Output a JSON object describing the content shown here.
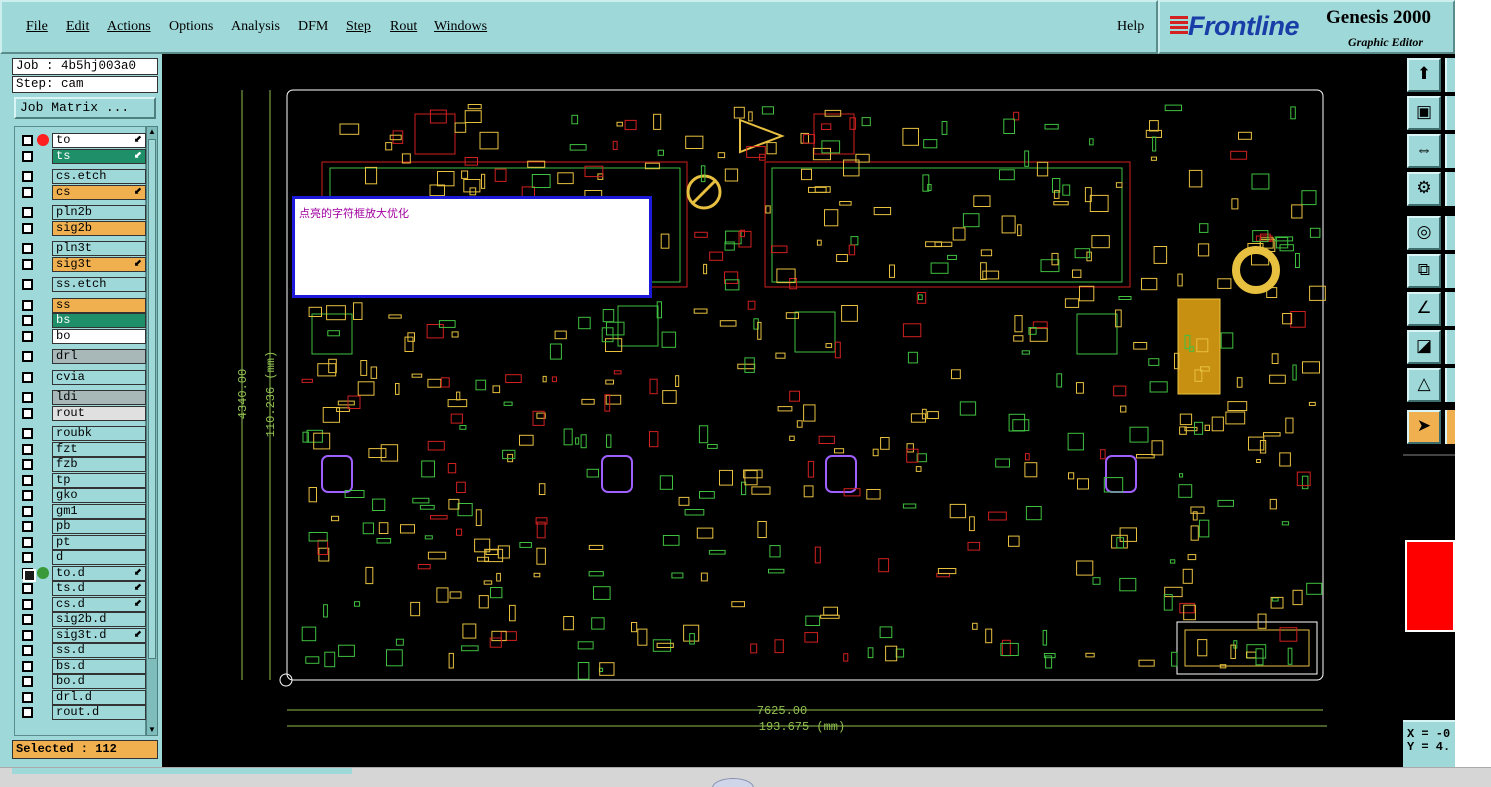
{
  "menubar": {
    "items": [
      {
        "label": "File",
        "underline": true
      },
      {
        "label": "Edit",
        "underline": true
      },
      {
        "label": "Actions",
        "underline": true
      },
      {
        "label": "Options",
        "underline": false
      },
      {
        "label": "Analysis",
        "underline": false
      },
      {
        "label": "DFM",
        "underline": false
      },
      {
        "label": "Step",
        "underline": true
      },
      {
        "label": "Rout",
        "underline": true
      },
      {
        "label": "Windows",
        "underline": true
      }
    ],
    "help": "Help"
  },
  "logo": {
    "brand": "Frontline",
    "product": "Genesis 2000",
    "subtitle": "Graphic Editor"
  },
  "job": {
    "job_line": "Job : 4b5hj003a0",
    "step_line": "Step: cam",
    "matrix_button": "Job Matrix ..."
  },
  "layers": [
    {
      "name": "to",
      "color": "#ffffff",
      "dot": "#ff2020",
      "arrow": true
    },
    {
      "name": "ts",
      "color": "#1f8f6a",
      "arrow": true,
      "textColor": "#ffffff"
    },
    {
      "name": "cs.etch",
      "color": "#9fd8d8",
      "gap": true
    },
    {
      "name": "cs",
      "color": "#f0b050",
      "arrow": true
    },
    {
      "name": "pln2b",
      "color": "#9fd8d8",
      "gap": true
    },
    {
      "name": "sig2b",
      "color": "#f0b050"
    },
    {
      "name": "pln3t",
      "color": "#9fd8d8",
      "gap": true
    },
    {
      "name": "sig3t",
      "color": "#f0b050",
      "arrow": true
    },
    {
      "name": "ss.etch",
      "color": "#9fd8d8",
      "gap": true
    },
    {
      "name": "ss",
      "color": "#f0b050",
      "gap": true
    },
    {
      "name": "bs",
      "color": "#1f8f6a",
      "textColor": "#ffffff"
    },
    {
      "name": "bo",
      "color": "#ffffff"
    },
    {
      "name": "drl",
      "color": "#a8b8b8",
      "gap": true
    },
    {
      "name": "cvia",
      "color": "#9fd8d8",
      "gap": true
    },
    {
      "name": "ldi",
      "color": "#a8b8b8",
      "gap": true
    },
    {
      "name": "rout",
      "color": "#e0e0e0"
    },
    {
      "name": "roubk",
      "color": "#9fd8d8",
      "gap": true
    },
    {
      "name": "fzt",
      "color": "#9fd8d8"
    },
    {
      "name": "fzb",
      "color": "#9fd8d8"
    },
    {
      "name": "tp",
      "color": "#9fd8d8"
    },
    {
      "name": "gko",
      "color": "#9fd8d8"
    },
    {
      "name": "gm1",
      "color": "#9fd8d8"
    },
    {
      "name": "pb",
      "color": "#9fd8d8"
    },
    {
      "name": "pt",
      "color": "#9fd8d8"
    },
    {
      "name": "d",
      "color": "#9fd8d8"
    },
    {
      "name": "to.d",
      "color": "#9fd8d8",
      "dot": "#3a9a3a",
      "arrow": true,
      "active": true
    },
    {
      "name": "ts.d",
      "color": "#9fd8d8",
      "arrow": true
    },
    {
      "name": "cs.d",
      "color": "#9fd8d8",
      "arrow": true
    },
    {
      "name": "sig2b.d",
      "color": "#9fd8d8"
    },
    {
      "name": "sig3t.d",
      "color": "#9fd8d8",
      "arrow": true
    },
    {
      "name": "ss.d",
      "color": "#9fd8d8"
    },
    {
      "name": "bs.d",
      "color": "#9fd8d8"
    },
    {
      "name": "bo.d",
      "color": "#9fd8d8"
    },
    {
      "name": "drl.d",
      "color": "#9fd8d8"
    },
    {
      "name": "rout.d",
      "color": "#9fd8d8"
    }
  ],
  "selected": "Selected : 112",
  "canvas": {
    "tooltip_text": "点亮的字符框放大优化",
    "dim_width": "7625.00",
    "dim_width_mm": "193.675 (mm)",
    "dim_height": "4340.00",
    "dim_height_mm": "110.236 (mm)",
    "board_colors": {
      "outline": "#ffffff",
      "silk": "#e8c040",
      "green": "#40c040",
      "red": "#d02020",
      "purple": "#a060ff"
    }
  },
  "coords": {
    "x_line": "X = -0",
    "y_line": "Y = 4."
  },
  "right_tools": [
    {
      "name": "export-icon",
      "glyph": "⬆"
    },
    {
      "name": "frame-icon",
      "glyph": "▣"
    },
    {
      "name": "fit-icon",
      "glyph": "⇔"
    },
    {
      "name": "settings-icon",
      "glyph": "⚙"
    },
    {
      "name": "snap-icon",
      "glyph": "◎"
    },
    {
      "name": "route-icon",
      "glyph": "⧉"
    },
    {
      "name": "measure-icon",
      "glyph": "∠"
    },
    {
      "name": "pad-icon",
      "glyph": "◪"
    },
    {
      "name": "triangle-icon",
      "glyph": "△"
    },
    {
      "name": "pointer-icon",
      "glyph": "➤"
    }
  ]
}
